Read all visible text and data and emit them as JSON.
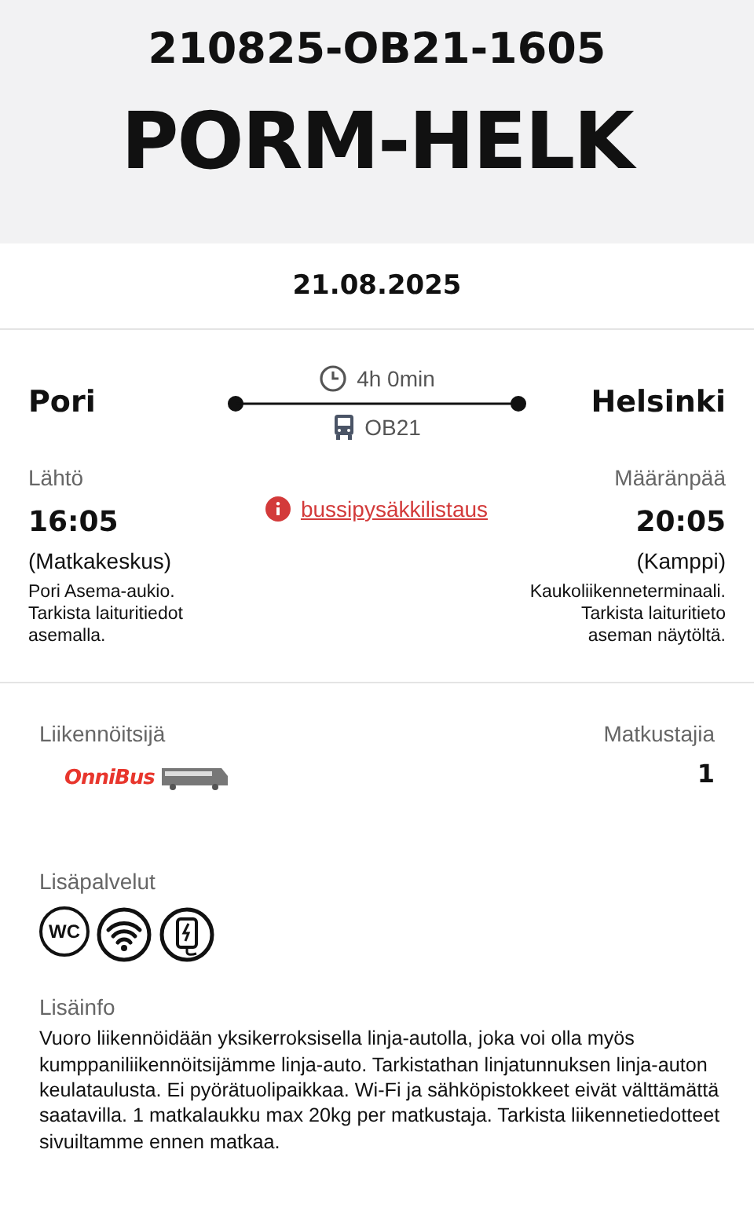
{
  "header": {
    "booking_code": "210825-OB21-1605",
    "route_code": "PORM-HELK"
  },
  "date": "21.08.2025",
  "journey": {
    "origin": "Pori",
    "destination": "Helsinki",
    "duration": "4h 0min",
    "line": "OB21",
    "stop_list_link": "bussipysäkkilistaus",
    "departure": {
      "label": "Lähtö",
      "time": "16:05",
      "station": "(Matkakeskus)",
      "note": "Pori Asema-aukio. Tarkista laituritiedot asemalla."
    },
    "arrival": {
      "label": "Määränpää",
      "time": "20:05",
      "station": "(Kamppi)",
      "note": "Kaukoliikenneterminaali. Tarkista laituritieto aseman näytöltä."
    }
  },
  "operator": {
    "label": "Liikennöitsijä",
    "logo_text": "OnniBus"
  },
  "passengers": {
    "label": "Matkustajia",
    "count": "1"
  },
  "services": {
    "label": "Lisäpalvelut",
    "items": [
      {
        "kind": "wc",
        "text": "WC"
      },
      {
        "kind": "wifi"
      },
      {
        "kind": "charging"
      }
    ]
  },
  "info": {
    "label": "Lisäinfo",
    "text": "Vuoro liikennöidään yksikerroksisella linja-autolla, joka voi olla myös kumppaniliikennöitsijämme linja-auto. Tarkistathan linjatunnuksen linja-auton keulataulusta. Ei pyörätuolipaikkaa. Wi-Fi ja sähköpistokkeet eivät välttämättä saatavilla. 1 matkalaukku max 20kg per matkustaja. Tarkista liikennetiedotteet sivuiltamme ennen matkaa."
  }
}
